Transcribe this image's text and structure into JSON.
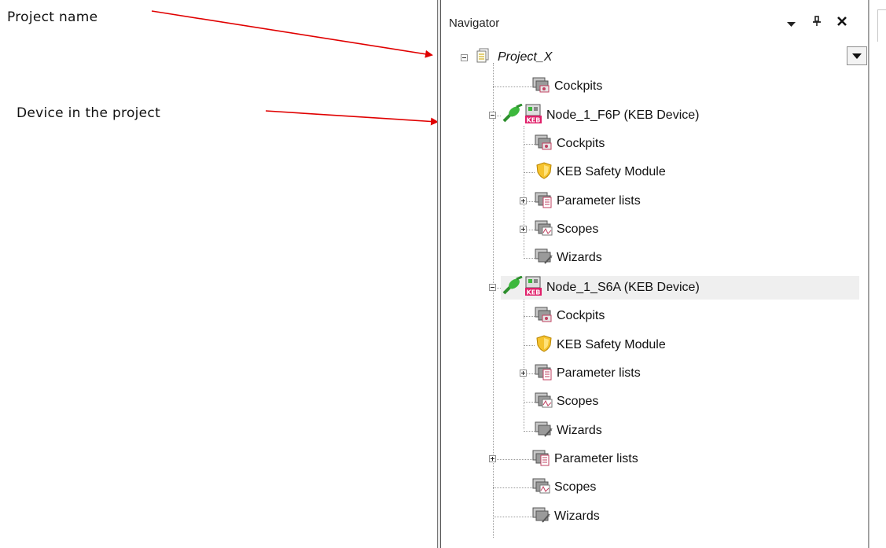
{
  "annotations": {
    "project_name": "Project name",
    "device_in_project": "Device in the project"
  },
  "navigator": {
    "title": "Navigator",
    "buttons": {
      "menu_icon": "dropdown-arrow-icon",
      "pin_icon": "pin-icon",
      "close_icon": "close-icon"
    }
  },
  "tree": {
    "project": "Project_X",
    "project_cockpits": "Cockpits",
    "device1": {
      "label": "Node_1_F6P (KEB Device)",
      "cockpits": "Cockpits",
      "safety": "KEB Safety Module",
      "parameter_lists": "Parameter lists",
      "scopes": "Scopes",
      "wizards": "Wizards"
    },
    "device2": {
      "label": "Node_1_S6A (KEB Device)",
      "cockpits": "Cockpits",
      "safety": "KEB Safety Module",
      "parameter_lists": "Parameter lists",
      "scopes": "Scopes",
      "wizards": "Wizards"
    },
    "parameter_lists": "Parameter lists",
    "scopes": "Scopes",
    "wizards": "Wizards"
  },
  "colors": {
    "arrow": "#e00000",
    "highlight": "#efefef",
    "connector_green": "#3db83d",
    "keb_red": "#e0206a"
  }
}
